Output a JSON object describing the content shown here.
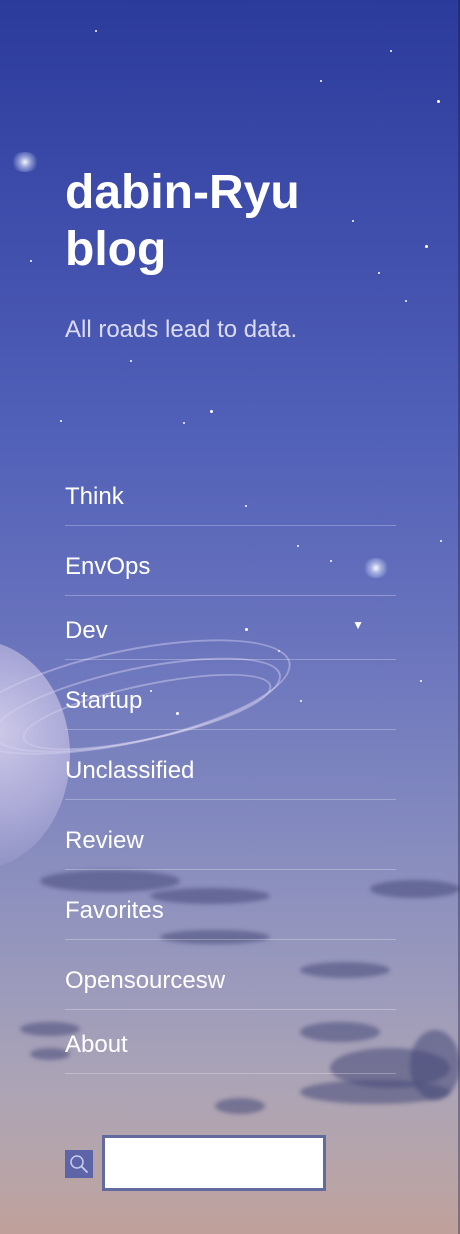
{
  "site": {
    "title": "dabin-Ryu blog",
    "description": "All roads lead to data."
  },
  "nav": {
    "items": [
      {
        "label": "Think"
      },
      {
        "label": "EnvOps"
      },
      {
        "label": "Dev",
        "has_dropdown": true
      },
      {
        "label": "Startup"
      },
      {
        "label": "Unclassified"
      },
      {
        "label": "Review"
      },
      {
        "label": "Favorites"
      },
      {
        "label": "Opensourcesw"
      },
      {
        "label": "About"
      }
    ],
    "dropdown_glyph": "▼"
  },
  "search": {
    "icon": "search-icon",
    "value": "",
    "placeholder": ""
  },
  "colors": {
    "sky_top": "#2b3b9b",
    "sky_bottom": "#c0a09a",
    "search_icon_bg": "#5d64a8",
    "search_border": "#626a9e"
  }
}
